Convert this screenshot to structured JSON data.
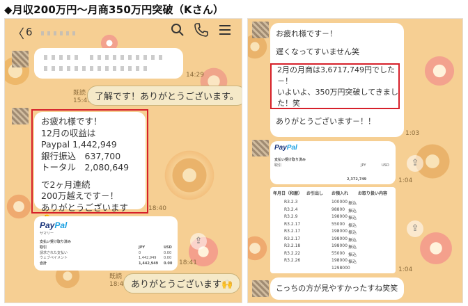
{
  "heading": "◆月収200万円〜月商350万円突破（Kさん）",
  "left": {
    "topbar": {
      "back": "〈",
      "count": "6"
    },
    "times": {
      "t1": "14:29",
      "t2_read": "既読",
      "t2": "15:41",
      "t3": "18:40",
      "t4": "18:41",
      "t5_read": "既読",
      "t5": "18:41"
    },
    "reply1": "了解です！ありがとうございます。",
    "msg_lines": [
      "お疲れ様です！",
      "12月の収益は",
      "Paypal 1,442,949",
      "銀行振込　637,700",
      "トータル　2,080,649",
      "",
      "で2ヶ月連続",
      "200万越えです－！",
      "ありがとうございます🐣"
    ],
    "paypal": {
      "logo_a": "Pay",
      "logo_b": "Pal",
      "sub": "サマリー",
      "title": "支払い受け取り済み",
      "col1": "取引",
      "col2": "JPY",
      "col3": "USD",
      "rows": [
        [
          "請求された支払い",
          "0",
          "0.00"
        ],
        [
          "ウェブペイメント",
          "1,442,949",
          "0.00"
        ],
        [
          "合計",
          "1,442,949",
          "0.00"
        ]
      ]
    },
    "reply2": "ありがとうございます🙌"
  },
  "right": {
    "msg1_lines": [
      "お疲れ様です－！",
      "",
      "遅くなってすいません笑"
    ],
    "msg2_lines": [
      "2月の月商は3,6717,749円でした－！",
      "いよいよ、350万円突破してきました！笑"
    ],
    "msg3": "ありがとうございます－！！",
    "times": {
      "t1": "1:03",
      "t2": "1:04",
      "t3": "1:04"
    },
    "paypal": {
      "logo_a": "Pay",
      "logo_b": "Pal",
      "title": "支払い受け取り済み",
      "cols": [
        "取引",
        "JPY",
        "USD"
      ],
      "total": "2,372,749"
    },
    "bank": {
      "headers": [
        "年月日（和暦）",
        "お引出し",
        "お預入れ",
        "お取り扱い内容"
      ],
      "rows": [
        [
          "R3.2.3",
          "100000",
          "振込"
        ],
        [
          "R3.2.4",
          "98800",
          "振込"
        ],
        [
          "R3.2.9",
          "198000",
          "振込"
        ],
        [
          "R3.2.17",
          "55000",
          "振込"
        ],
        [
          "R3.2.17",
          "198000",
          "振込"
        ],
        [
          "R3.2.17",
          "198000",
          "振込"
        ],
        [
          "R3.2.18",
          "198000",
          "振込"
        ],
        [
          "R3.2.22",
          "55000",
          "振込"
        ],
        [
          "R3.2.26",
          "198000",
          "振込"
        ],
        [
          "",
          "1298000",
          ""
        ]
      ]
    },
    "msg4": "こっちの方が見やすかったすね笑笑"
  },
  "colors": {
    "accent_red": "#d6202a",
    "bg": "#f6cf93",
    "paypal_dark": "#17327a",
    "paypal_light": "#1ba0e2"
  }
}
